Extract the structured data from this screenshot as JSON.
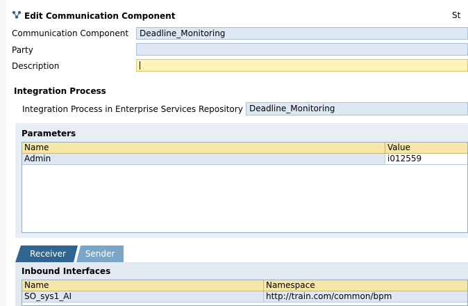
{
  "header": {
    "icon": "communication-component-icon",
    "title": "Edit Communication Component",
    "status_fragment": "St"
  },
  "form": {
    "communication_component": {
      "label": "Communication Component",
      "value": "Deadline_Monitoring"
    },
    "party": {
      "label": "Party",
      "value": ""
    },
    "description": {
      "label": "Description",
      "value": ""
    }
  },
  "integration_process": {
    "heading": "Integration Process",
    "repository_label": "Integration Process in Enterprise Services Repository",
    "repository_value": "Deadline_Monitoring"
  },
  "parameters": {
    "heading": "Parameters",
    "columns": [
      "Name",
      "Value"
    ],
    "rows": [
      {
        "name": "Admin",
        "value": "i012559"
      }
    ]
  },
  "tabs": [
    {
      "label": "Receiver",
      "active": true
    },
    {
      "label": "Sender",
      "active": false
    }
  ],
  "inbound_interfaces": {
    "heading": "Inbound Interfaces",
    "columns": [
      "Name",
      "Namespace"
    ],
    "rows": [
      {
        "name": "SO_sys1_AI",
        "namespace": "http://train.com/common/bpm"
      }
    ]
  },
  "colors": {
    "field_bg": "#dde8f4",
    "active_field_bg": "#fff3b8",
    "table_header_bg": "#f6e6a8",
    "tab_active": "#2f6590",
    "tab_inactive": "#7aa6c9"
  }
}
